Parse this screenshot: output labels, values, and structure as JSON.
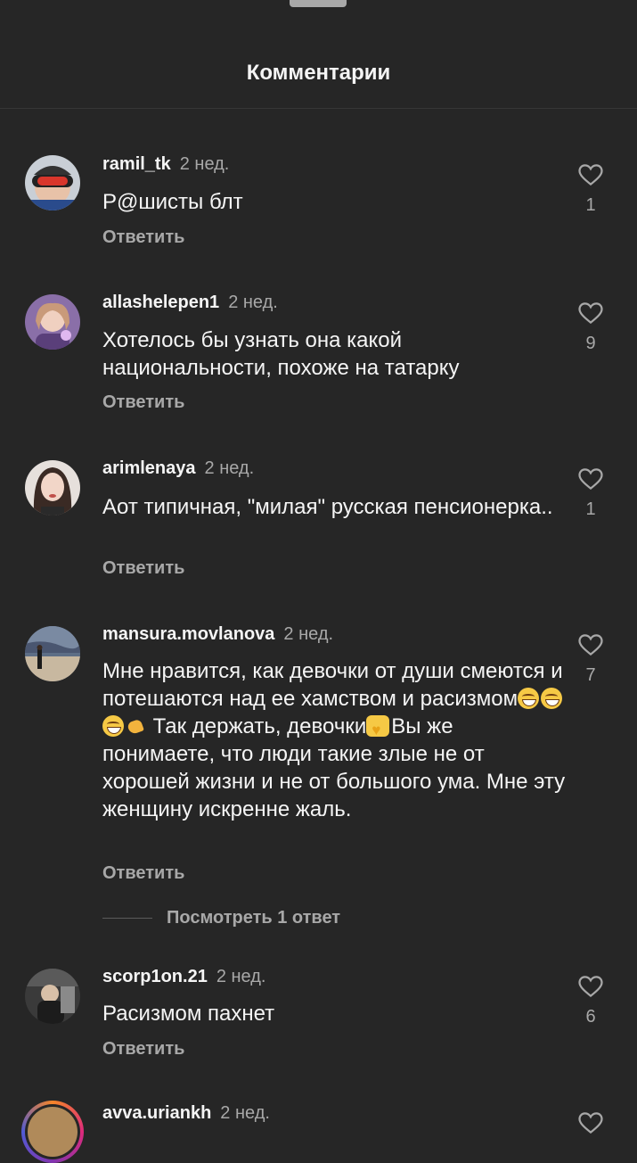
{
  "header": {
    "title": "Комментарии"
  },
  "comments": [
    {
      "username": "ramil_tk",
      "time": "2 нед.",
      "text": "Р@шисты блт",
      "reply": "Ответить",
      "likes": "1"
    },
    {
      "username": "allashelepen1",
      "time": "2 нед.",
      "text": "Хотелось бы узнать она какой национальности, похоже на татарку",
      "reply": "Ответить",
      "likes": "9"
    },
    {
      "username": "arimlenaya",
      "time": "2 нед.",
      "text": "Аот типичная, \"милая\"  русская пенсионерка..",
      "reply": "Ответить",
      "likes": "1"
    },
    {
      "username": "mansura.movlanova",
      "time": "2 нед.",
      "text_parts": [
        "Мне нравится, как девочки от души смеются и потешаются над ее хамством и расизмом",
        " Так держать, девочки",
        "Вы же понимаете, что люди такие злые не от хорошей жизни и не от большого ума. Мне эту женщину искренне жаль."
      ],
      "reply": "Ответить",
      "likes": "7",
      "view_replies": "Посмотреть 1 ответ"
    },
    {
      "username": "scorp1on.21",
      "time": "2 нед.",
      "text": "Расизмом пахнет",
      "reply": "Ответить",
      "likes": "6"
    },
    {
      "username": "avva.uriankh",
      "time": "2 нед."
    }
  ],
  "icons": {
    "like": "heart-outline-icon"
  },
  "colors": {
    "background": "#262626",
    "secondary_text": "#a8a8a8",
    "primary_text": "#f5f5f5"
  }
}
